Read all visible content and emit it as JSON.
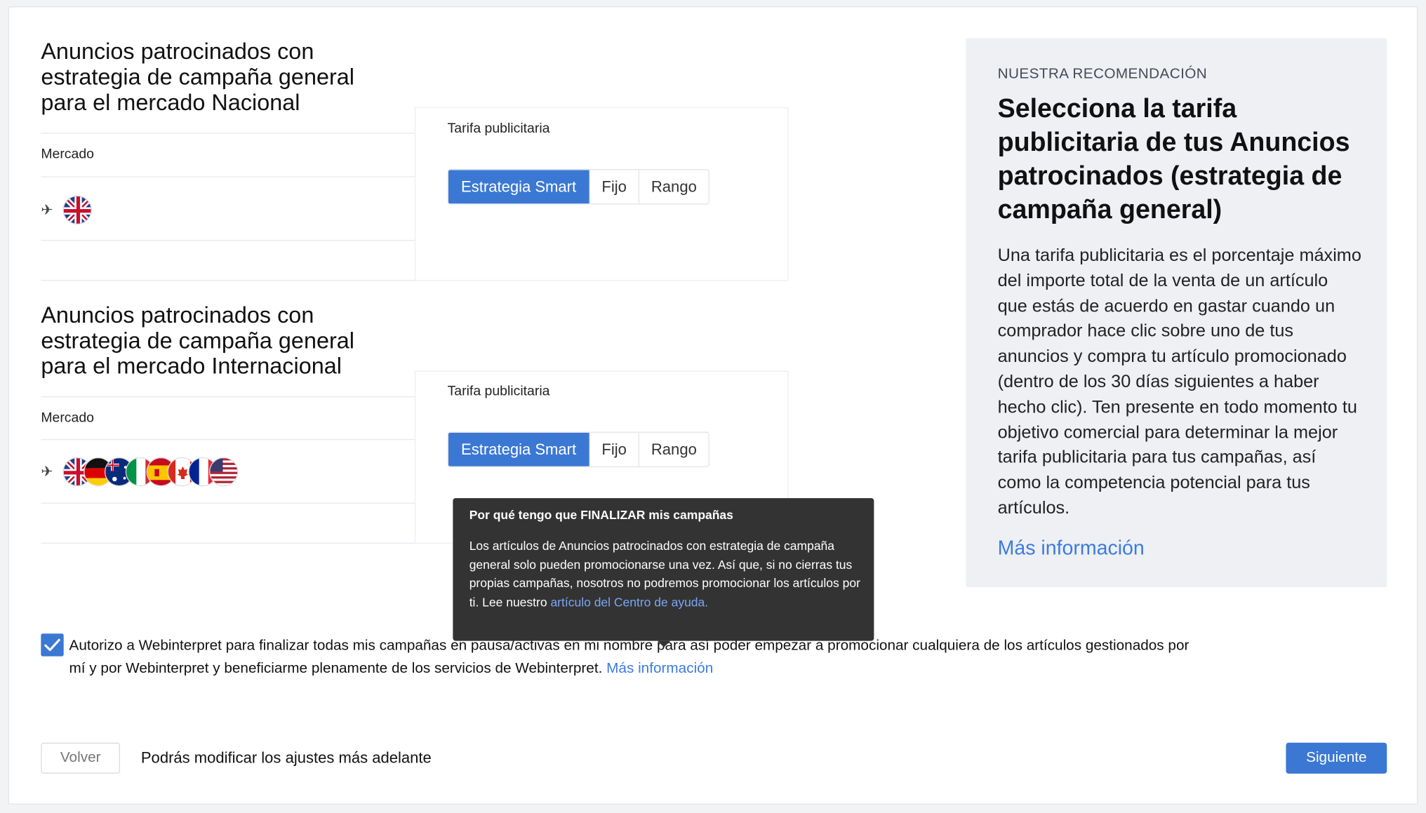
{
  "sections": [
    {
      "title": "Anuncios patrocinados con estrategia de campaña general para el mercado Nacional",
      "market_label": "Mercado",
      "markets": [
        "uk"
      ],
      "rate_label": "Tarifa publicitaria",
      "options": [
        "Estrategia Smart",
        "Fijo",
        "Rango"
      ],
      "selected": "Estrategia Smart"
    },
    {
      "title": "Anuncios patrocinados con estrategia de campaña general para el mercado Internacional",
      "market_label": "Mercado",
      "markets": [
        "uk",
        "de",
        "au",
        "it",
        "es",
        "ca",
        "fr",
        "us"
      ],
      "rate_label": "Tarifa publicitaria",
      "options": [
        "Estrategia Smart",
        "Fijo",
        "Rango"
      ],
      "selected": "Estrategia Smart"
    }
  ],
  "recommendation": {
    "eyebrow": "NUESTRA RECOMENDACIÓN",
    "title": "Selecciona la tarifa publicitaria de tus Anuncios patrocinados (estrategia de campaña general)",
    "body": "Una tarifa publicitaria es el porcentaje máximo del importe total de la venta de un artículo que estás de acuerdo en gastar cuando un comprador hace clic sobre uno de tus anuncios y compra tu artículo promocionado (dentro de los 30 días siguientes a haber hecho clic). Ten presente en todo momento tu objetivo comercial para determinar la mejor tarifa publicitaria para tus campañas, así como la competencia potencial para tus artículos.",
    "link": "Más información"
  },
  "tooltip": {
    "title": "Por qué tengo que FINALIZAR mis campañas",
    "body": "Los artículos de Anuncios patrocinados con estrategia de campaña general solo pueden promocionarse una vez. Así que, si no cierras tus propias campañas, nosotros no podremos promocionar los artículos por ti. Lee nuestro",
    "link": "artículo del Centro de ayuda."
  },
  "consent": {
    "checked": true,
    "text": "Autorizo a Webinterpret para finalizar todas mis campañas en pausa/activas en mi nombre para así poder empezar a promocionar cualquiera de los artículos gestionados por mí y por Webinterpret y beneficiarme plenamente de los servicios de Webinterpret.",
    "link": "Más información"
  },
  "footer": {
    "back": "Volver",
    "note": "Podrás modificar los ajustes más adelante",
    "next": "Siguiente"
  },
  "colors": {
    "accent": "#3b78d4",
    "link": "#3d7be0",
    "tooltip_bg": "#333333",
    "panel_bg": "#eef0f4"
  },
  "icons": [
    "smart-strategy-icon",
    "flag-uk-icon",
    "flag-de-icon",
    "flag-au-icon",
    "flag-it-icon",
    "flag-es-icon",
    "flag-ca-icon",
    "flag-fr-icon",
    "flag-us-icon",
    "checkmark-icon"
  ]
}
